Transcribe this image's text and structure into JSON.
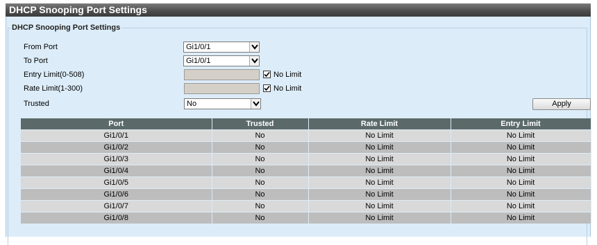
{
  "title": "DHCP Snooping Port Settings",
  "fieldset_legend": "DHCP Snooping Port Settings",
  "form": {
    "from_port": {
      "label": "From Port",
      "value": "Gi1/0/1"
    },
    "to_port": {
      "label": "To Port",
      "value": "Gi1/0/1"
    },
    "entry_limit": {
      "label": "Entry Limit(0-508)",
      "value": "",
      "no_limit_label": "No Limit",
      "no_limit_checked": true
    },
    "rate_limit": {
      "label": "Rate Limit(1-300)",
      "value": "",
      "no_limit_label": "No Limit",
      "no_limit_checked": true
    },
    "trusted": {
      "label": "Trusted",
      "value": "No"
    },
    "apply_label": "Apply"
  },
  "table": {
    "headers": [
      "Port",
      "Trusted",
      "Rate Limit",
      "Entry Limit"
    ],
    "rows": [
      [
        "Gi1/0/1",
        "No",
        "No Limit",
        "No Limit"
      ],
      [
        "Gi1/0/2",
        "No",
        "No Limit",
        "No Limit"
      ],
      [
        "Gi1/0/3",
        "No",
        "No Limit",
        "No Limit"
      ],
      [
        "Gi1/0/4",
        "No",
        "No Limit",
        "No Limit"
      ],
      [
        "Gi1/0/5",
        "No",
        "No Limit",
        "No Limit"
      ],
      [
        "Gi1/0/6",
        "No",
        "No Limit",
        "No Limit"
      ],
      [
        "Gi1/0/7",
        "No",
        "No Limit",
        "No Limit"
      ],
      [
        "Gi1/0/8",
        "No",
        "No Limit",
        "No Limit"
      ]
    ]
  },
  "colors": {
    "panel_bg": "#dcecf8",
    "table_header": "#5b6a69",
    "row_light": "#d9d9d9",
    "row_dark": "#bdbdbd"
  },
  "icons": [
    "chevron-down-icon",
    "checkmark-icon"
  ]
}
